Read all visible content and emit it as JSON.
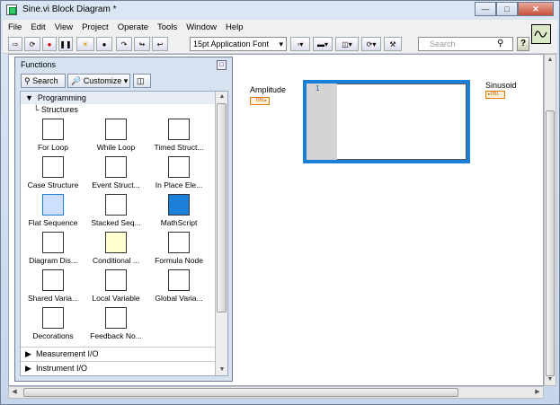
{
  "window": {
    "title": "Sine.vi Block Diagram *"
  },
  "menu": [
    "File",
    "Edit",
    "View",
    "Project",
    "Operate",
    "Tools",
    "Window",
    "Help"
  ],
  "toolbar": {
    "font": "15pt Application Font",
    "search_placeholder": "Search"
  },
  "palette": {
    "title": "Functions",
    "search_label": "Search",
    "customize_label": "Customize",
    "category_open": "Programming",
    "subcategory": "Structures",
    "items": [
      {
        "label": "For Loop",
        "icon": "for-loop-icon"
      },
      {
        "label": "While Loop",
        "icon": "while-loop-icon"
      },
      {
        "label": "Timed Struct...",
        "icon": "timed-structure-icon"
      },
      {
        "label": "Case Structure",
        "icon": "case-structure-icon"
      },
      {
        "label": "Event Struct...",
        "icon": "event-structure-icon"
      },
      {
        "label": "In Place Ele...",
        "icon": "in-place-element-icon"
      },
      {
        "label": "Flat Sequence",
        "icon": "flat-sequence-icon"
      },
      {
        "label": "Stacked Seq...",
        "icon": "stacked-sequence-icon"
      },
      {
        "label": "MathScript",
        "icon": "mathscript-icon"
      },
      {
        "label": "Diagram Dis...",
        "icon": "diagram-disable-icon"
      },
      {
        "label": "Conditional ...",
        "icon": "conditional-disable-icon"
      },
      {
        "label": "Formula Node",
        "icon": "formula-node-icon"
      },
      {
        "label": "Shared Varia...",
        "icon": "shared-variable-icon"
      },
      {
        "label": "Local Variable",
        "icon": "local-variable-icon"
      },
      {
        "label": "Global Varia...",
        "icon": "global-variable-icon"
      },
      {
        "label": "Decorations",
        "icon": "decorations-icon"
      },
      {
        "label": "Feedback No...",
        "icon": "feedback-node-icon"
      }
    ],
    "other_categories": [
      "Measurement I/O",
      "Instrument I/O"
    ]
  },
  "diagram": {
    "amplitude_label": "Amplitude",
    "sinusoid_label": "Sinusoid",
    "terminal_type": "DBL",
    "frame_number": "1"
  },
  "colors": {
    "structure_border": "#1a7fd6",
    "terminal": "#e07c00"
  }
}
